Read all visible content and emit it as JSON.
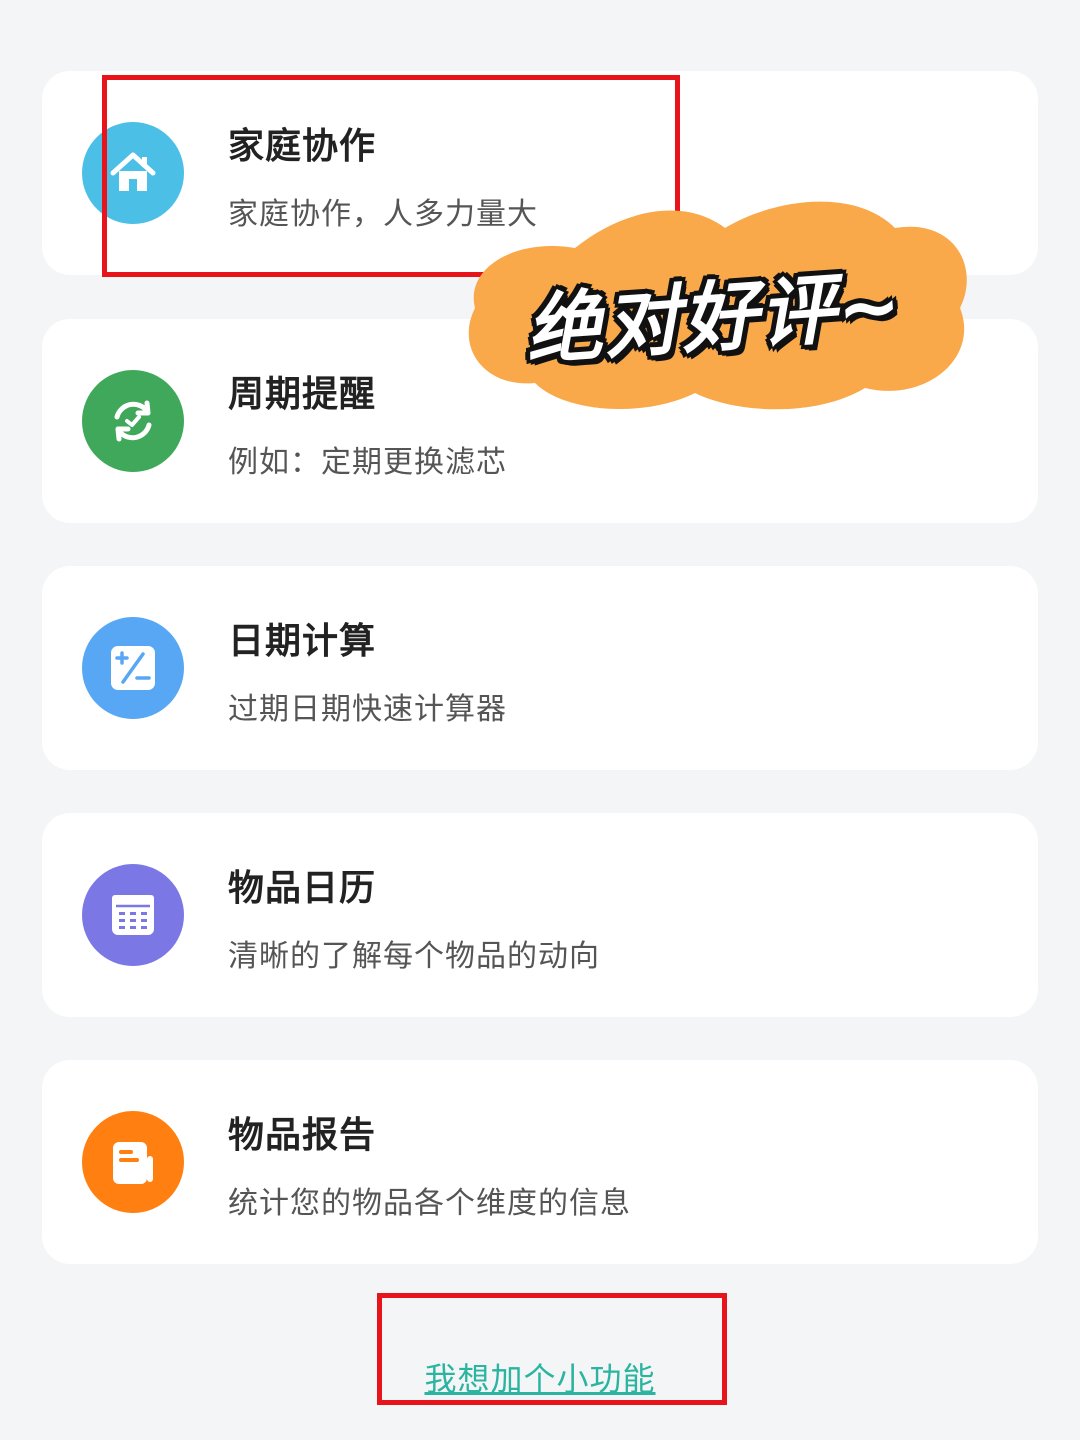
{
  "cards": [
    {
      "title": "家庭协作",
      "subtitle": "家庭协作，人多力量大",
      "icon": "home-icon",
      "icon_color": "#4cbfe6"
    },
    {
      "title": "周期提醒",
      "subtitle": "例如：定期更换滤芯",
      "icon": "cycle-refresh-icon",
      "icon_color": "#3fa85b"
    },
    {
      "title": "日期计算",
      "subtitle": "过期日期快速计算器",
      "icon": "calculator-icon",
      "icon_color": "#58a7f4"
    },
    {
      "title": "物品日历",
      "subtitle": "清晰的了解每个物品的动向",
      "icon": "calendar-icon",
      "icon_color": "#7b78e6"
    },
    {
      "title": "物品报告",
      "subtitle": "统计您的物品各个维度的信息",
      "icon": "report-icon",
      "icon_color": "#ff7f10"
    }
  ],
  "sticker": {
    "text": "绝对好评~",
    "color": "#f9a84a"
  },
  "footer": {
    "link_label": "我想加个小功能",
    "link_color": "#2bb5a0"
  },
  "highlight_color": "#e8141b",
  "background_color": "#f4f5f7"
}
